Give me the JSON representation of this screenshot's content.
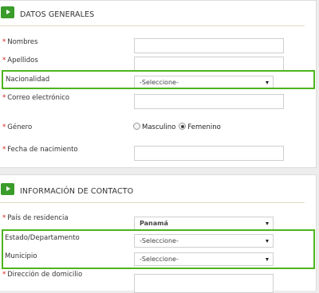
{
  "datos": {
    "title": "DATOS GENERALES",
    "nombres_label": "Nombres",
    "apellidos_label": "Apellidos",
    "nacionalidad_label": "Nacionalidad",
    "nacionalidad_value": "-Seleccione-",
    "correo_label": "Correo electrónico",
    "genero_label": "Género",
    "genero_options": [
      "Masculino",
      "Femenino"
    ],
    "genero_selected": "Femenino",
    "fecha_label": "Fecha de nacimiento"
  },
  "contacto": {
    "title": "INFORMACIÓN DE CONTACTO",
    "pais_label": "País de residencia",
    "pais_value": "Panamá",
    "estado_label": "Estado/Departamento",
    "estado_value": "-Seleccione-",
    "municipio_label": "Municipio",
    "municipio_value": "-Seleccione-",
    "direccion_label": "Dirección de domicilio"
  },
  "required_mark": "*",
  "colors": {
    "accent": "#3a9c2a",
    "highlight": "#4db51d",
    "required": "#d01818"
  }
}
